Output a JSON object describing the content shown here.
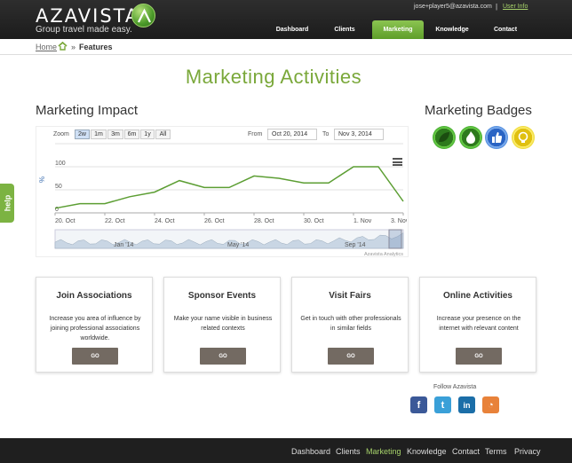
{
  "header": {
    "brand": "AZAVISTA",
    "tagline": "Group travel made easy.",
    "user_email": "jose+player5@azavista.com",
    "user_sep": "|",
    "user_info": "User Info",
    "nav": [
      "Dashboard",
      "Clients",
      "Marketing",
      "Knowledge",
      "Contact"
    ],
    "active_nav": "Marketing"
  },
  "breadcrumb": {
    "home": "Home",
    "sep": "»",
    "current": "Features"
  },
  "page_title": "Marketing Activities",
  "impact": {
    "title": "Marketing Impact",
    "zoom_label": "Zoom",
    "zoom_options": [
      "2w",
      "1m",
      "3m",
      "6m",
      "1y",
      "All"
    ],
    "zoom_selected": "2w",
    "from_label": "From",
    "from_value": "Oct 20, 2014",
    "to_label": "To",
    "to_value": "Nov 3, 2014",
    "credit": "Azavista Analytics"
  },
  "chart_data": {
    "type": "line",
    "ylabel": "%",
    "y_ticks": [
      "0",
      "50",
      "100"
    ],
    "ylim": [
      0,
      150
    ],
    "x_ticks": [
      "20. Oct",
      "22. Oct",
      "24. Oct",
      "26. Oct",
      "28. Oct",
      "30. Oct",
      "1. Nov",
      "3. Nov"
    ],
    "series": [
      {
        "x": [
          "2014-10-20",
          "2014-10-21",
          "2014-10-22",
          "2014-10-23",
          "2014-10-24",
          "2014-10-25",
          "2014-10-26",
          "2014-10-27",
          "2014-10-28",
          "2014-10-29",
          "2014-10-30",
          "2014-10-31",
          "2014-11-01",
          "2014-11-02",
          "2014-11-03"
        ],
        "values": [
          10,
          20,
          20,
          35,
          45,
          70,
          55,
          55,
          80,
          75,
          65,
          65,
          100,
          100,
          25
        ]
      }
    ],
    "navigator_ticks": [
      "Jan '14",
      "May '14",
      "Sep '14"
    ],
    "grid": true
  },
  "badges": {
    "title": "Marketing Badges",
    "items": [
      {
        "name": "leaf-badge",
        "color": "#3aa02a"
      },
      {
        "name": "flame-badge",
        "color": "#3aa02a"
      },
      {
        "name": "thumbs-up-badge",
        "color": "#3d7ed8"
      },
      {
        "name": "lightbulb-badge",
        "color": "#e8d020"
      }
    ]
  },
  "cards": [
    {
      "title": "Join Associations",
      "desc": "Increase you area of influence by joining professional associations worldwide.",
      "button": "GO"
    },
    {
      "title": "Sponsor Events",
      "desc": "Make your name visible in business related contexts",
      "button": "GO"
    },
    {
      "title": "Visit Fairs",
      "desc": "Get in touch with other professionals in similar fields",
      "button": "GO"
    },
    {
      "title": "Online Activities",
      "desc": "Increase your presence on the internet with relevant content",
      "button": "GO"
    }
  ],
  "social": {
    "label": "Follow Azavista",
    "items": [
      {
        "name": "facebook-icon",
        "glyph": "f",
        "color": "#3b5998"
      },
      {
        "name": "twitter-icon",
        "glyph": "t",
        "color": "#3aa0d8"
      },
      {
        "name": "linkedin-icon",
        "glyph": "in",
        "color": "#1b6ea8"
      },
      {
        "name": "rss-icon",
        "glyph": "◔",
        "color": "#e8823a"
      }
    ]
  },
  "footer": {
    "links": [
      "Dashboard",
      "Clients",
      "Marketing",
      "Knowledge",
      "Contact",
      "Terms",
      "Privacy"
    ],
    "active": "Marketing"
  },
  "help": "help"
}
